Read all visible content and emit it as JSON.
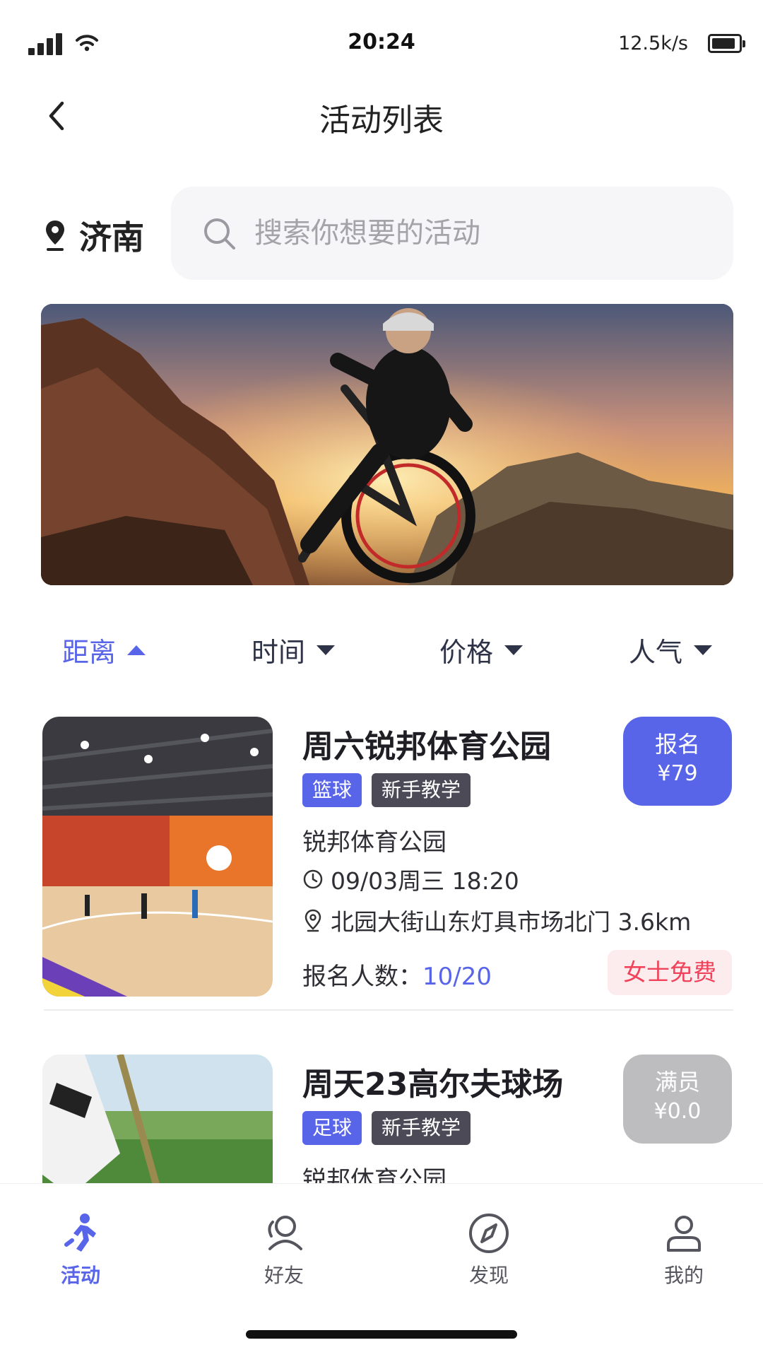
{
  "status_bar": {
    "time": "20:24",
    "net_speed": "12.5k/s"
  },
  "header": {
    "title": "活动列表"
  },
  "location": {
    "city": "济南"
  },
  "search": {
    "placeholder": "搜索你想要的活动"
  },
  "sort_tabs": [
    {
      "label": "距离",
      "active": true,
      "direction": "up"
    },
    {
      "label": "时间",
      "active": false,
      "direction": "down"
    },
    {
      "label": "价格",
      "active": false,
      "direction": "down"
    },
    {
      "label": "人气",
      "active": false,
      "direction": "down"
    }
  ],
  "activities": [
    {
      "title": "周六锐邦体育公园",
      "tags": [
        "篮球",
        "新手教学"
      ],
      "venue": "锐邦体育公园",
      "time": "09/03周三 18:20",
      "address": "北园大街山东灯具市场北门 3.6km",
      "signup_label": "报名人数：",
      "signup_count": "10/20",
      "cta_label": "报名",
      "cta_price": "¥79",
      "badge": "女士免费"
    },
    {
      "title": "周天23高尔夫球场",
      "tags": [
        "足球",
        "新手教学"
      ],
      "venue": "锐邦体育公园",
      "cta_label": "满员",
      "cta_price": "¥0.0"
    }
  ],
  "tab_bar": [
    {
      "label": "活动",
      "icon": "running-person-icon",
      "active": true
    },
    {
      "label": "好友",
      "icon": "friends-icon",
      "active": false
    },
    {
      "label": "发现",
      "icon": "compass-icon",
      "active": false
    },
    {
      "label": "我的",
      "icon": "user-icon",
      "active": false
    }
  ],
  "colors": {
    "accent": "#5865e8",
    "dark_tag": "#4b4a56",
    "full_gray": "#bdbdc0",
    "badge_bg": "#fdecee",
    "badge_text": "#f0425a"
  }
}
